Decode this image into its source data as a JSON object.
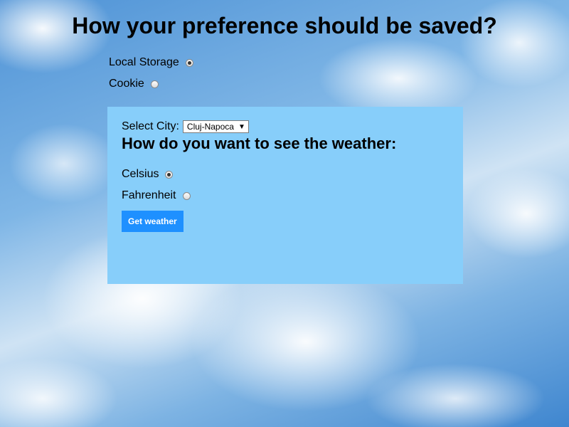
{
  "page": {
    "title": "How your preference should be saved?"
  },
  "storage": {
    "options": [
      {
        "label": "Local Storage",
        "checked": true
      },
      {
        "label": "Cookie",
        "checked": false
      }
    ]
  },
  "weather_form": {
    "city_label": "Select City:",
    "city_selected": "Cluj-Napoca",
    "heading": "How do you want to see the weather:",
    "units": [
      {
        "label": "Celsius",
        "checked": true
      },
      {
        "label": "Fahrenheit",
        "checked": false
      }
    ],
    "button_label": "Get weather"
  },
  "colors": {
    "panel_bg": "#87cefa",
    "button_bg": "#1e90ff",
    "button_text": "#ffffff"
  },
  "icons": {
    "select_arrow": "dropdown-arrow-icon"
  }
}
